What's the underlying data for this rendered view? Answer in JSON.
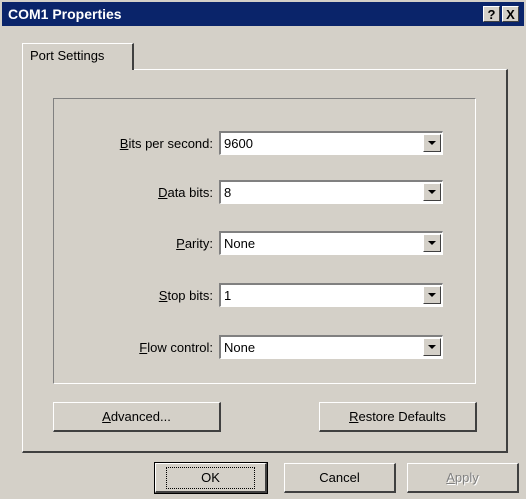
{
  "window": {
    "title": "COM1 Properties",
    "help_label": "?",
    "close_label": "X"
  },
  "tab": {
    "label": "Port Settings"
  },
  "fields": [
    {
      "key": "B",
      "rest": "its per second:",
      "value": "9600"
    },
    {
      "key": "D",
      "rest": "ata bits:",
      "value": "8"
    },
    {
      "key": "P",
      "rest": "arity:",
      "value": "None"
    },
    {
      "key": "S",
      "rest": "top bits:",
      "value": "1"
    },
    {
      "key": "F",
      "rest": "low control:",
      "value": "None"
    }
  ],
  "buttons": {
    "advanced": {
      "key": "A",
      "rest": "dvanced..."
    },
    "restore": {
      "key": "R",
      "rest": "estore Defaults"
    },
    "ok": "OK",
    "cancel": "Cancel",
    "apply": {
      "key": "A",
      "rest": "pply"
    }
  }
}
